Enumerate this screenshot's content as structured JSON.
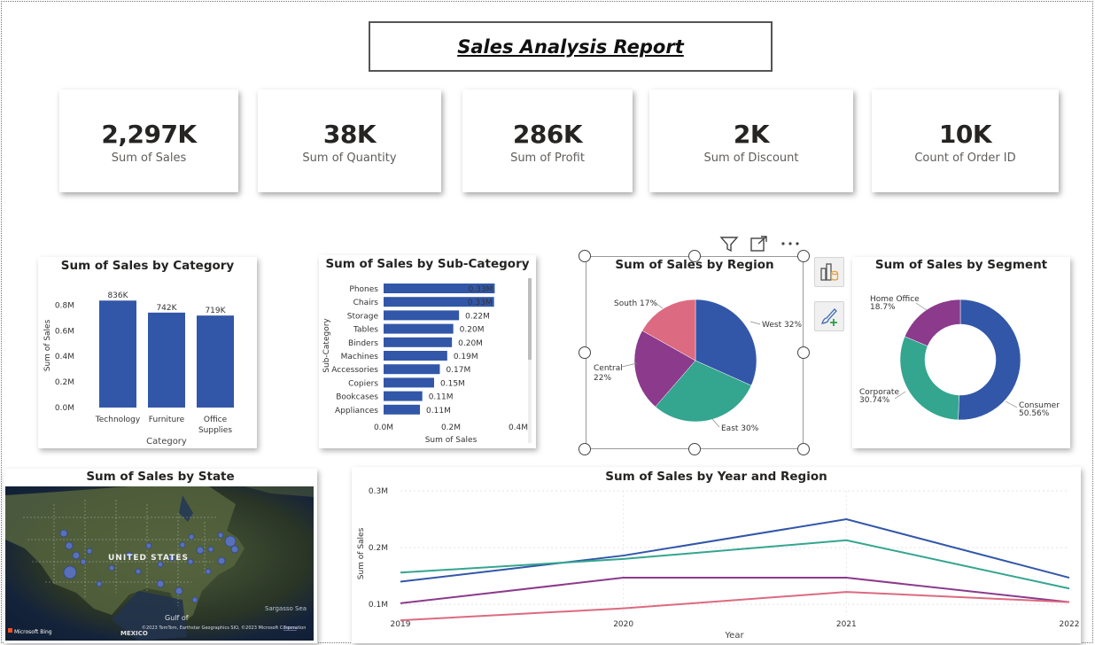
{
  "report": {
    "title": "Sales Analysis Report"
  },
  "kpis": [
    {
      "value": "2,297K",
      "label": "Sum of Sales"
    },
    {
      "value": "38K",
      "label": "Sum of Quantity"
    },
    {
      "value": "286K",
      "label": "Sum of Profit"
    },
    {
      "value": "2K",
      "label": "Sum of Discount"
    },
    {
      "value": "10K",
      "label": "Count of Order ID"
    }
  ],
  "colors": {
    "blue": "#3257a8",
    "teal": "#34a58f",
    "purple": "#8b3a8c",
    "pink": "#dc6a80"
  },
  "visual_toolbar": {
    "icons": [
      "filter-icon",
      "focus-mode-icon",
      "more-options-icon"
    ]
  },
  "side_panel": {
    "icons": [
      "build-visual-icon",
      "format-visual-icon"
    ]
  },
  "chart_data": [
    {
      "type": "bar",
      "title": "Sum of Sales by Category",
      "xlabel": "Category",
      "ylabel": "Sum of Sales",
      "categories": [
        "Technology",
        "Furniture",
        "Office Supplies"
      ],
      "category_lines": [
        [
          "Technology"
        ],
        [
          "Furniture"
        ],
        [
          "Office",
          "Supplies"
        ]
      ],
      "values": [
        836000,
        742000,
        719000
      ],
      "data_labels": [
        "836K",
        "742K",
        "719K"
      ],
      "yticks": [
        "0.0M",
        "0.2M",
        "0.4M",
        "0.6M",
        "0.8M"
      ],
      "ylim": [
        0,
        900000
      ]
    },
    {
      "type": "bar",
      "orientation": "horizontal",
      "title": "Sum of Sales by Sub-Category",
      "xlabel": "Sum of Sales",
      "ylabel": "Sub-Category",
      "categories": [
        "Phones",
        "Chairs",
        "Storage",
        "Tables",
        "Binders",
        "Machines",
        "Accessories",
        "Copiers",
        "Bookcases",
        "Appliances"
      ],
      "values": [
        330000,
        328000,
        224000,
        207000,
        203000,
        189000,
        167000,
        150000,
        115000,
        108000
      ],
      "data_labels": [
        "0.33M",
        "0.33M",
        "0.22M",
        "0.20M",
        "0.20M",
        "0.19M",
        "0.17M",
        "0.15M",
        "0.11M",
        "0.11M"
      ],
      "xticks": [
        "0.0M",
        "0.2M",
        "0.4M"
      ],
      "xlim": [
        0,
        400000
      ]
    },
    {
      "type": "pie",
      "title": "Sum of Sales by Region",
      "labels": [
        "West",
        "East",
        "Central",
        "South"
      ],
      "values": [
        32,
        30,
        22,
        17
      ],
      "data_labels": [
        "West 32%",
        "East 30%",
        [
          "Central",
          "22%"
        ],
        "South 17%"
      ]
    },
    {
      "type": "pie",
      "donut": true,
      "title": "Sum of Sales by Segment",
      "labels": [
        "Consumer",
        "Corporate",
        "Home Office"
      ],
      "values": [
        50.56,
        30.74,
        18.7
      ],
      "data_labels": [
        [
          "Consumer",
          "50.56%"
        ],
        [
          "Corporate",
          "30.74%"
        ],
        [
          "Home Office",
          "18.7%"
        ]
      ]
    },
    {
      "type": "map",
      "title": "Sum of Sales by State",
      "map_labels": [
        "UNITED STATES",
        "Gulf of",
        "MEXICO",
        "Sargasso Sea",
        "Microsoft Bing",
        "©2023 TomTom, Earthstar Geographics SIO, ©2023 Microsoft Corporation",
        "Terms"
      ]
    },
    {
      "type": "line",
      "title": "Sum of Sales by Year and Region",
      "xlabel": "Year",
      "ylabel": "Sum of Sales",
      "x": [
        "2019",
        "2020",
        "2021",
        "2022"
      ],
      "yticks": [
        "0.1M",
        "0.2M",
        "0.3M"
      ],
      "ylim": [
        0.08,
        0.3
      ],
      "series": [
        {
          "values": [
            0.14,
            0.186,
            0.25,
            0.147
          ]
        },
        {
          "values": [
            0.156,
            0.18,
            0.213,
            0.128
          ]
        },
        {
          "values": [
            0.102,
            0.147,
            0.147,
            0.104
          ]
        },
        {
          "values": [
            0.072,
            0.093,
            0.122,
            0.104
          ]
        }
      ]
    }
  ]
}
